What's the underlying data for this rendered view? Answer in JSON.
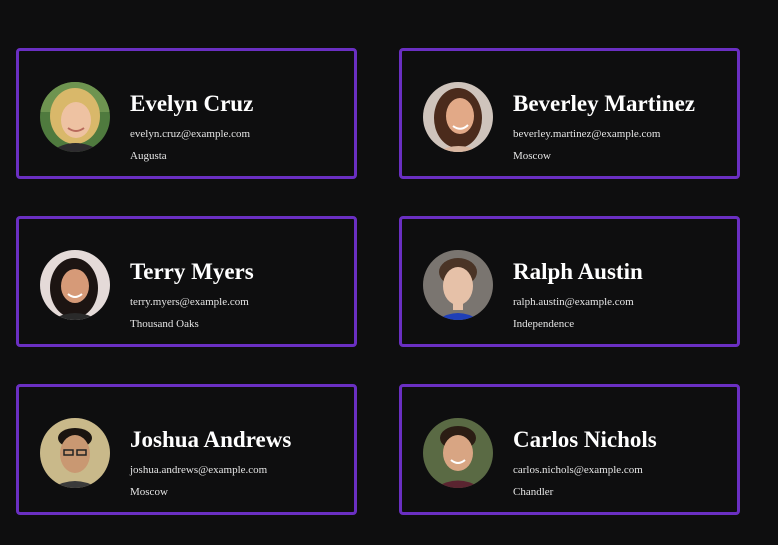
{
  "cards": [
    {
      "name": "Evelyn Cruz",
      "email": "evelyn.cruz@example.com",
      "city": "Augusta"
    },
    {
      "name": "Beverley Martinez",
      "email": "beverley.martinez@example.com",
      "city": "Moscow"
    },
    {
      "name": "Terry Myers",
      "email": "terry.myers@example.com",
      "city": "Thousand Oaks"
    },
    {
      "name": "Ralph Austin",
      "email": "ralph.austin@example.com",
      "city": "Independence"
    },
    {
      "name": "Joshua Andrews",
      "email": "joshua.andrews@example.com",
      "city": "Moscow"
    },
    {
      "name": "Carlos Nichols",
      "email": "carlos.nichols@example.com",
      "city": "Chandler"
    }
  ],
  "colors": {
    "background": "#0e0e0f",
    "card_border": "#6a2fc2",
    "text": "#ffffff"
  }
}
